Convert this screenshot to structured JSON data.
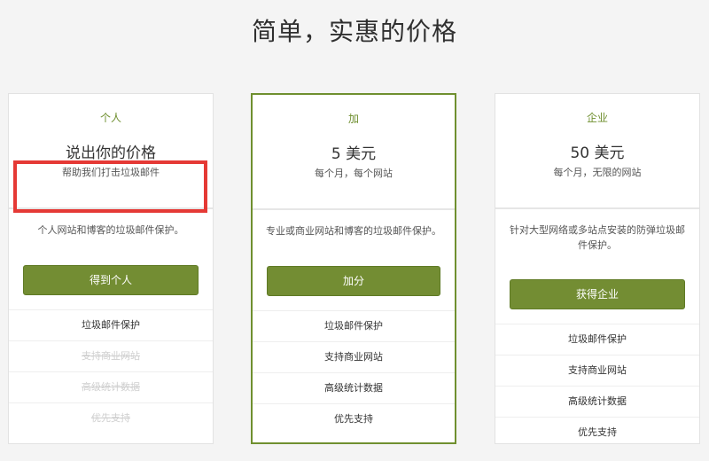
{
  "page": {
    "title": "简单，实惠的价格"
  },
  "plans": [
    {
      "tier": "个人",
      "price": "说出你的价格",
      "subprice": "帮助我们打击垃圾邮件",
      "description": "个人网站和博客的垃圾邮件保护。",
      "cta": "得到个人",
      "features": [
        {
          "label": "垃圾邮件保护",
          "enabled": true
        },
        {
          "label": "支持商业网站",
          "enabled": false
        },
        {
          "label": "高级统计数据",
          "enabled": false
        },
        {
          "label": "优先支持",
          "enabled": false
        }
      ]
    },
    {
      "tier": "加",
      "price": "5 美元",
      "subprice": "每个月，每个网站",
      "description": "专业或商业网站和博客的垃圾邮件保护。",
      "cta": "加分",
      "features": [
        {
          "label": "垃圾邮件保护",
          "enabled": true
        },
        {
          "label": "支持商业网站",
          "enabled": true
        },
        {
          "label": "高级统计数据",
          "enabled": true
        },
        {
          "label": "优先支持",
          "enabled": true
        }
      ]
    },
    {
      "tier": "企业",
      "price": "50 美元",
      "subprice": "每个月，无限的网站",
      "description": "针对大型网络或多站点安装的防弹垃圾邮件保护。",
      "cta": "获得企业",
      "features": [
        {
          "label": "垃圾邮件保护",
          "enabled": true
        },
        {
          "label": "支持商业网站",
          "enabled": true
        },
        {
          "label": "高级统计数据",
          "enabled": true
        },
        {
          "label": "优先支持",
          "enabled": true
        }
      ]
    }
  ],
  "colors": {
    "accent": "#738d33",
    "highlight": "#e53935"
  }
}
